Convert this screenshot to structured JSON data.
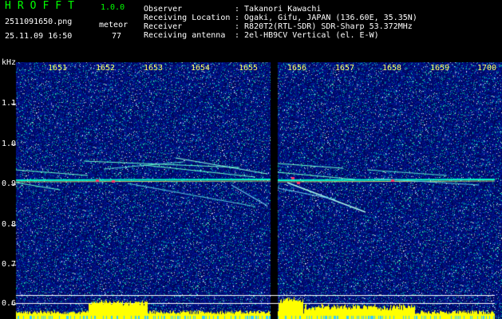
{
  "header": {
    "app_title": "HROFFT",
    "version": "1.0.0",
    "filename": "2511091650.png",
    "datetime": "25.11.09 16:50",
    "meteor_label": "meteor",
    "meteor_count": "77",
    "info_labels": {
      "observer": "Observer",
      "location": "Receiving Location",
      "receiver": "Receiver",
      "antenna": "Receiving antenna"
    },
    "info_values": {
      "observer": ": Takanori Kawachi",
      "location": ": Ogaki, Gifu, JAPAN (136.60E, 35.35N)",
      "receiver": ": R820T2(RTL-SDR) SDR-Sharp 53.372MHz",
      "antenna": ": 2el-HB9CV Vertical (el. E-W)"
    }
  },
  "axes": {
    "y_unit": "kHz",
    "y_ticks": [
      "1.1",
      "1.0",
      "0.9",
      "0.8",
      "0.7",
      "0.6"
    ],
    "x_ticks": [
      "1651",
      "1652",
      "1653",
      "1654",
      "1655",
      "1656",
      "1657",
      "1658",
      "1659",
      "1700"
    ]
  },
  "colors": {
    "background": "#000000",
    "noise": "#0a1a8a",
    "carrier": "#00ffcc",
    "trail": "#a0ffe0",
    "level": "#ffff00"
  }
}
